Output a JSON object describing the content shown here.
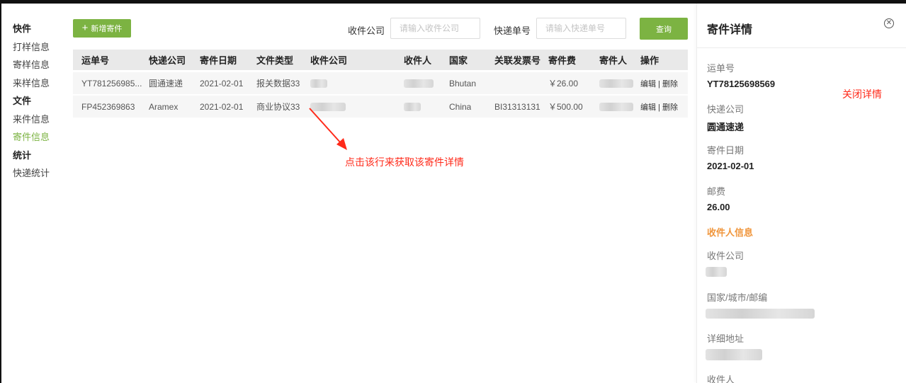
{
  "sidebar": {
    "groups": [
      {
        "label": "快件",
        "items": [
          "打样信息",
          "寄样信息",
          "来样信息"
        ]
      },
      {
        "label": "文件",
        "items": [
          "来件信息",
          "寄件信息"
        ]
      },
      {
        "label": "统计",
        "items": [
          "快递统计"
        ]
      }
    ],
    "active_item": "寄件信息"
  },
  "toolbar": {
    "add_label": "新增寄件",
    "company_label": "收件公司",
    "company_placeholder": "请输入收件公司",
    "tracking_label": "快递单号",
    "tracking_placeholder": "请输入快递单号",
    "search_label": "查询"
  },
  "table": {
    "headers": [
      "运单号",
      "快递公司",
      "寄件日期",
      "文件类型",
      "收件公司",
      "收件人",
      "国家",
      "关联发票号",
      "寄件费",
      "寄件人",
      "操作"
    ],
    "rows": [
      {
        "waybill": "YT781256985...",
        "courier": "圆通速递",
        "date": "2021-02-01",
        "doc_type": "报关数据33",
        "country": "Bhutan",
        "invoice": "",
        "fee": "￥26.00"
      },
      {
        "waybill": "FP452369863",
        "courier": "Aramex",
        "date": "2021-02-01",
        "doc_type": "商业协议33",
        "country": "China",
        "invoice": "BI31313131",
        "fee": "￥500.00"
      }
    ],
    "edit_label": "编辑",
    "delete_label": "删除",
    "separator": "|"
  },
  "annotations": {
    "row_hint": "点击该行来获取该寄件详情",
    "close_hint": "关闭详情"
  },
  "detail": {
    "title": "寄件详情",
    "waybill_label": "运单号",
    "waybill_value": "YT78125698569",
    "courier_label": "快递公司",
    "courier_value": "圆通速递",
    "date_label": "寄件日期",
    "date_value": "2021-02-01",
    "postage_label": "邮费",
    "postage_value": "26.00",
    "recipient_section": "收件人信息",
    "company_label": "收件公司",
    "location_label": "国家/城市/邮编",
    "address_label": "详细地址",
    "recipient_label": "收件人"
  },
  "colors": {
    "accent": "#7cb342",
    "annotation": "#ff2a1a",
    "section": "#f0963c"
  }
}
